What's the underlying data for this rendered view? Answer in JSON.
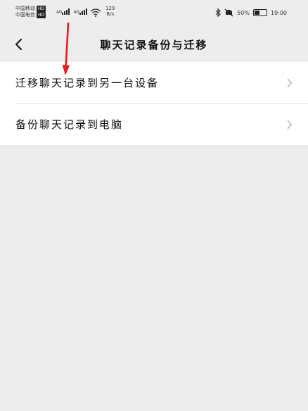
{
  "status_bar": {
    "carrier1": "中国移动",
    "carrier2": "中国电信",
    "hd_badge": "HD",
    "network1": "4G",
    "network2": "4G",
    "net_speed_value": "129",
    "net_speed_unit": "B/s",
    "battery_percent": "50",
    "battery_level": 0.5,
    "time": "19:00",
    "icons": [
      "bluetooth-icon",
      "mute-icon",
      "battery-icon",
      "wifi-icon",
      "signal-icon"
    ]
  },
  "nav": {
    "title": "聊天记录备份与迁移",
    "back_icon": "chevron-left-icon"
  },
  "items": [
    {
      "label": "迁移聊天记录到另一台设备",
      "icon": "chevron-right-icon"
    },
    {
      "label": "备份聊天记录到电脑",
      "icon": "chevron-right-icon"
    }
  ],
  "colors": {
    "background": "#ededed",
    "card": "#ffffff",
    "annotation_arrow": "#e02020",
    "chevron": "#b2b2b2"
  }
}
